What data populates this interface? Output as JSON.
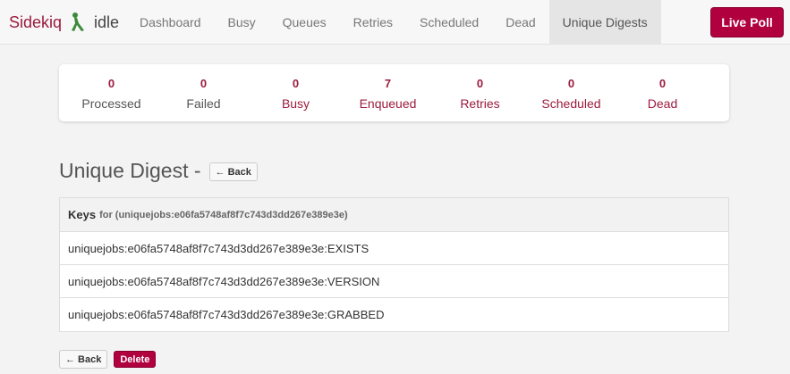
{
  "brand": {
    "name": "Sidekiq",
    "status": "idle",
    "icon": "sidekiq-figure-icon"
  },
  "nav": {
    "items": [
      {
        "label": "Dashboard"
      },
      {
        "label": "Busy"
      },
      {
        "label": "Queues"
      },
      {
        "label": "Retries"
      },
      {
        "label": "Scheduled"
      },
      {
        "label": "Dead"
      },
      {
        "label": "Unique Digests"
      }
    ],
    "active_index": 6
  },
  "live_poll_label": "Live Poll",
  "summary": [
    {
      "count": "0",
      "label": "Processed"
    },
    {
      "count": "0",
      "label": "Failed"
    },
    {
      "count": "0",
      "label": "Busy"
    },
    {
      "count": "7",
      "label": "Enqueued"
    },
    {
      "count": "0",
      "label": "Retries"
    },
    {
      "count": "0",
      "label": "Scheduled"
    },
    {
      "count": "0",
      "label": "Dead"
    }
  ],
  "page": {
    "title": "Unique Digest -",
    "back_label": "← Back"
  },
  "table": {
    "header_keys": "Keys",
    "header_for": "for (uniquejobs:e06fa5748af8f7c743d3dd267e389e3e)",
    "rows": [
      "uniquejobs:e06fa5748af8f7c743d3dd267e389e3e:EXISTS",
      "uniquejobs:e06fa5748af8f7c743d3dd267e389e3e:VERSION",
      "uniquejobs:e06fa5748af8f7c743d3dd267e389e3e:GRABBED"
    ]
  },
  "actions": {
    "back_label": "← Back",
    "delete_label": "Delete"
  },
  "colors": {
    "brand": "#9c1b3f",
    "danger": "#b1003e",
    "background": "#f3f3f3"
  }
}
